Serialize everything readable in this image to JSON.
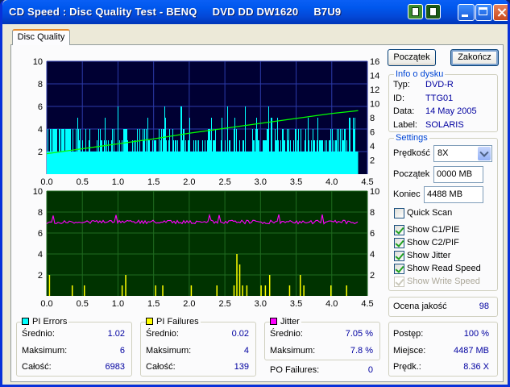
{
  "window": {
    "title": "CD Speed : Disc Quality Test - BENQ     DVD DD DW1620     B7U9"
  },
  "tab": {
    "label": "Disc Quality"
  },
  "buttons": {
    "start": "Początek",
    "close": "Zakończ"
  },
  "disc_info": {
    "title": "Info o dysku",
    "rows": [
      {
        "label": "Typ:",
        "value": "DVD-R"
      },
      {
        "label": "ID:",
        "value": "TTG01"
      },
      {
        "label": "Data:",
        "value": "14 May 2005"
      },
      {
        "label": "Label:",
        "value": "SOLARIS"
      }
    ]
  },
  "settings": {
    "title": "Settings",
    "speed_label": "Prędkość",
    "speed_value": "8X",
    "start_label": "Początek",
    "start_value": "0000 MB",
    "end_label": "Koniec",
    "end_value": "4488 MB",
    "quick_scan": {
      "label": "Quick Scan",
      "checked": false
    },
    "checkboxes": [
      {
        "label": "Show C1/PIE",
        "checked": true,
        "disabled": false
      },
      {
        "label": "Show C2/PIF",
        "checked": true,
        "disabled": false
      },
      {
        "label": "Show Jitter",
        "checked": true,
        "disabled": false
      },
      {
        "label": "Show Read Speed",
        "checked": true,
        "disabled": false
      },
      {
        "label": "Show Write Speed",
        "checked": true,
        "disabled": true
      }
    ]
  },
  "quality": {
    "label": "Ocena jakość",
    "value": "98"
  },
  "progress": {
    "rows": [
      {
        "label": "Postęp:",
        "value": "100 %"
      },
      {
        "label": "Miejsce:",
        "value": "4487 MB"
      },
      {
        "label": "Prędk.:",
        "value": "8.36 X"
      }
    ]
  },
  "pi_errors": {
    "title": "PI Errors",
    "color": "#00ffff",
    "rows": [
      {
        "label": "Średnio:",
        "value": "1.02"
      },
      {
        "label": "Maksimum:",
        "value": "6"
      },
      {
        "label": "Całość:",
        "value": "6983"
      }
    ]
  },
  "pi_failures": {
    "title": "PI Failures",
    "color": "#ffff00",
    "rows": [
      {
        "label": "Średnio:",
        "value": "0.02"
      },
      {
        "label": "Maksimum:",
        "value": "4"
      },
      {
        "label": "Całość:",
        "value": "139"
      }
    ]
  },
  "jitter": {
    "title": "Jitter",
    "color": "#ff00ff",
    "rows": [
      {
        "label": "Średnio:",
        "value": "7.05 %"
      },
      {
        "label": "Maksimum:",
        "value": "7.8 %"
      }
    ]
  },
  "po_failures": {
    "label": "PO Failures:",
    "value": "0"
  },
  "chart_data": [
    {
      "type": "bar",
      "title": "",
      "x_range": [
        0,
        4.5
      ],
      "x_ticks": [
        "0.0",
        "0.5",
        "1.0",
        "1.5",
        "2.0",
        "2.5",
        "3.0",
        "3.5",
        "4.0",
        "4.5"
      ],
      "y_left_ticks": [
        "2",
        "4",
        "6",
        "8",
        "10"
      ],
      "y_left_range": [
        0,
        10
      ],
      "y_right_ticks": [
        "2",
        "4",
        "6",
        "8",
        "10",
        "12",
        "14",
        "16"
      ],
      "y_right_range": [
        0,
        16
      ],
      "grid": true,
      "background": "#000033",
      "series": [
        {
          "kind": "bar",
          "color": "#00ffff",
          "x_end": 4.37,
          "baseline": 2,
          "max": 6,
          "note_values_y": "most bars 1-3, spikes up to 6"
        },
        {
          "kind": "line",
          "color": "#00ff00",
          "x": [
            0.0,
            0.5,
            1.0,
            1.5,
            2.0,
            2.5,
            3.0,
            3.5,
            4.0,
            4.37
          ],
          "y": [
            2.9,
            3.6,
            4.3,
            5.0,
            5.8,
            6.5,
            7.2,
            7.9,
            8.6,
            9.0
          ]
        }
      ]
    },
    {
      "type": "bar",
      "title": "",
      "x_range": [
        0,
        4.5
      ],
      "x_ticks": [
        "0.0",
        "0.5",
        "1.0",
        "1.5",
        "2.0",
        "2.5",
        "3.0",
        "3.5",
        "4.0",
        "4.5"
      ],
      "y_left_ticks": [
        "2",
        "4",
        "6",
        "8",
        "10"
      ],
      "y_right_ticks": [
        "2",
        "4",
        "6",
        "8",
        "10"
      ],
      "y_range": [
        0,
        10
      ],
      "grid": true,
      "background": "#003300",
      "series": [
        {
          "kind": "bar",
          "color": "#ffff00",
          "x": [
            0.03,
            0.35,
            0.52,
            1.05,
            1.1,
            1.52,
            1.62,
            2.02,
            2.38,
            2.62,
            2.66,
            2.7,
            2.74,
            2.8,
            3.0,
            3.06,
            3.12,
            3.4,
            3.55,
            3.6,
            3.98,
            4.2
          ],
          "y": [
            2,
            1,
            1,
            1,
            2,
            1,
            1,
            1,
            1,
            1,
            4,
            3,
            1,
            1,
            1,
            1,
            2,
            1,
            2,
            1,
            1,
            1
          ]
        },
        {
          "kind": "line",
          "color": "#ff00ff",
          "name": "Jitter",
          "mean": 7.05,
          "max": 7.8,
          "x_end": 4.37
        }
      ]
    }
  ]
}
